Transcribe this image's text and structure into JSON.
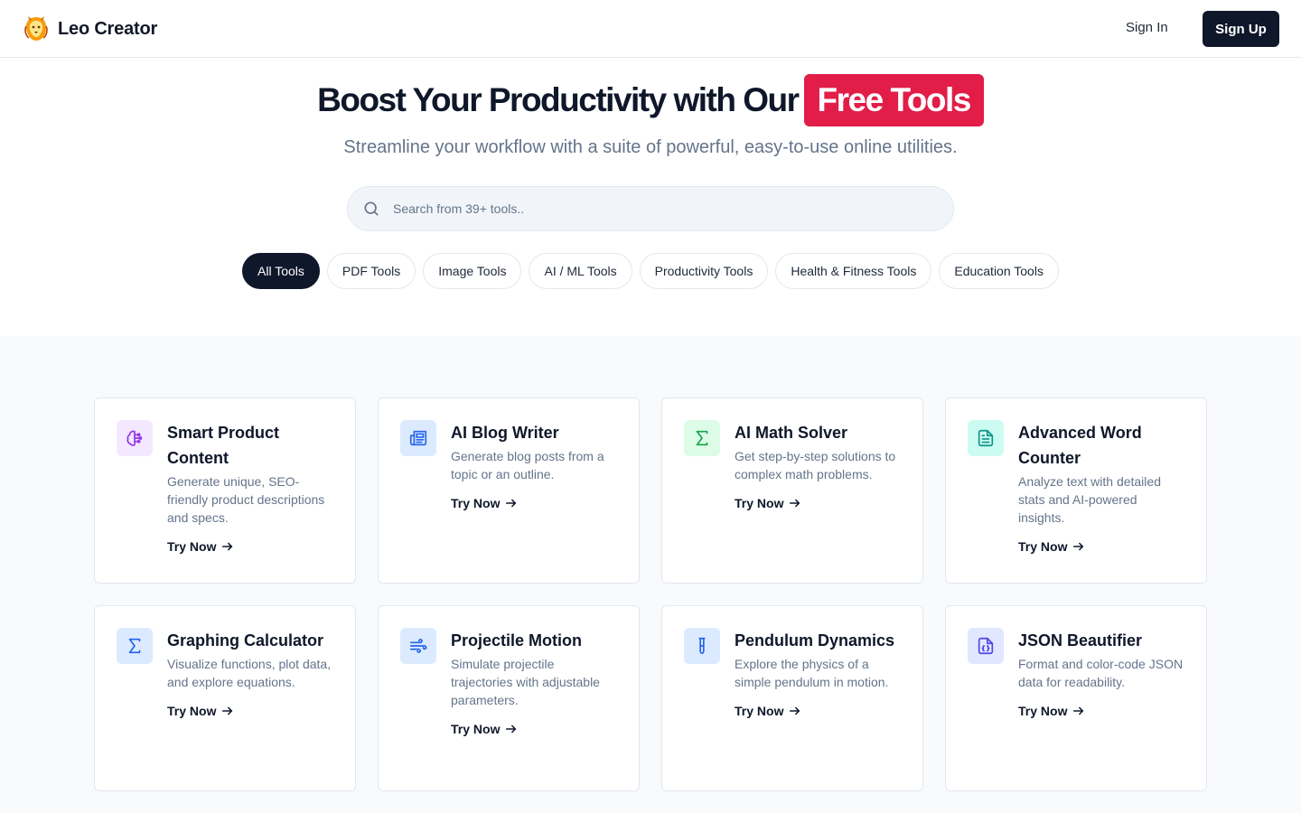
{
  "header": {
    "brand": "Leo Creator",
    "logo_icon": "lion-logo-icon",
    "sign_in": "Sign In",
    "sign_up": "Sign Up"
  },
  "hero": {
    "title": "Boost Your Productivity with Our",
    "title_accent": "Free Tools",
    "subtitle": "Streamline your workflow with a suite of powerful, easy-to-use online utilities.",
    "accent_color": "#e11d48"
  },
  "search": {
    "placeholder": "Search from 39+ tools..",
    "icon": "search-icon"
  },
  "filters": [
    {
      "label": "All Tools",
      "active": true
    },
    {
      "label": "PDF Tools",
      "active": false
    },
    {
      "label": "Image Tools",
      "active": false
    },
    {
      "label": "AI / ML Tools",
      "active": false
    },
    {
      "label": "Productivity Tools",
      "active": false
    },
    {
      "label": "Health & Fitness Tools",
      "active": false
    },
    {
      "label": "Education Tools",
      "active": false
    }
  ],
  "tools": [
    {
      "title": "Smart Product Content",
      "description": "Generate unique, SEO-friendly product descriptions and specs.",
      "cta": "Try Now",
      "icon": "brain-circuit-icon",
      "color": "#9333ea"
    },
    {
      "title": "AI Blog Writer",
      "description": "Generate blog posts from a topic or an outline.",
      "cta": "Try Now",
      "icon": "newspaper-icon",
      "color": "#2563eb"
    },
    {
      "title": "AI Math Solver",
      "description": "Get step-by-step solutions to complex math problems.",
      "cta": "Try Now",
      "icon": "sigma-icon",
      "color": "#16a34a"
    },
    {
      "title": "Advanced Word Counter",
      "description": "Analyze text with detailed stats and AI-powered insights.",
      "cta": "Try Now",
      "icon": "file-text-icon",
      "color": "#0d9488"
    },
    {
      "title": "Graphing Calculator",
      "description": "Visualize functions, plot data, and explore equations.",
      "cta": "Try Now",
      "icon": "sigma-icon",
      "color": "#2563eb"
    },
    {
      "title": "Projectile Motion",
      "description": "Simulate projectile trajectories with adjustable parameters.",
      "cta": "Try Now",
      "icon": "wind-icon",
      "color": "#2563eb"
    },
    {
      "title": "Pendulum Dynamics",
      "description": "Explore the physics of a simple pendulum in motion.",
      "cta": "Try Now",
      "icon": "test-tube-icon",
      "color": "#2563eb"
    },
    {
      "title": "JSON Beautifier",
      "description": "Format and color-code JSON data for readability.",
      "cta": "Try Now",
      "icon": "file-json-icon",
      "color": "#4f46e5"
    }
  ]
}
